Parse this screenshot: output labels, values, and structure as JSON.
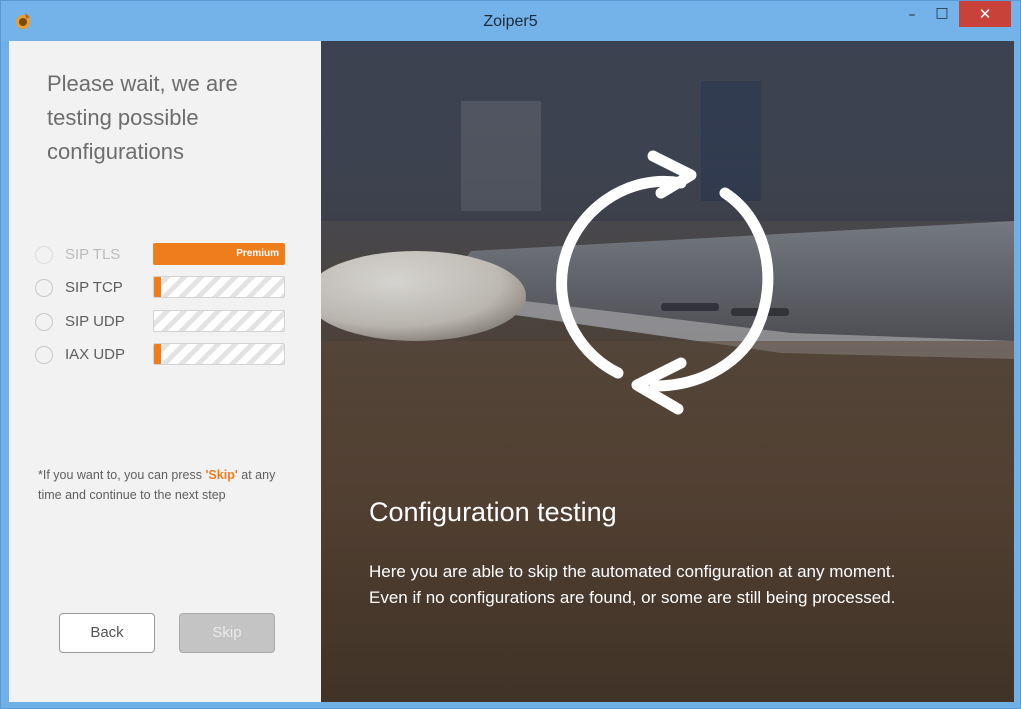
{
  "window": {
    "title": "Zoiper5",
    "minimize_glyph": "–",
    "maximize_glyph": "□",
    "close_glyph": "✕"
  },
  "left_panel": {
    "heading": "Please wait, we are testing possible configurations",
    "protocols": [
      {
        "label": "SIP TLS",
        "status": "premium",
        "badge": "Premium",
        "progress": null
      },
      {
        "label": "SIP TCP",
        "status": "testing",
        "progress": 0.05
      },
      {
        "label": "SIP UDP",
        "status": "testing",
        "progress": 0
      },
      {
        "label": "IAX UDP",
        "status": "testing",
        "progress": 0.05
      }
    ],
    "note_prefix": "*If you want to, you can press ",
    "note_skip": "'Skip'",
    "note_suffix": " at any time and continue to the next step",
    "back_label": "Back",
    "skip_label": "Skip"
  },
  "right_panel": {
    "title": "Configuration testing",
    "text": "Here you are able to skip the automated configuration at any moment. Even if no configurations are found, or some are still being processed."
  },
  "colors": {
    "accent": "#f07d1c",
    "titlebar": "#74b3ea",
    "close": "#c9423a"
  },
  "icons": [
    "app-logo-icon",
    "refresh-cycle-icon"
  ]
}
